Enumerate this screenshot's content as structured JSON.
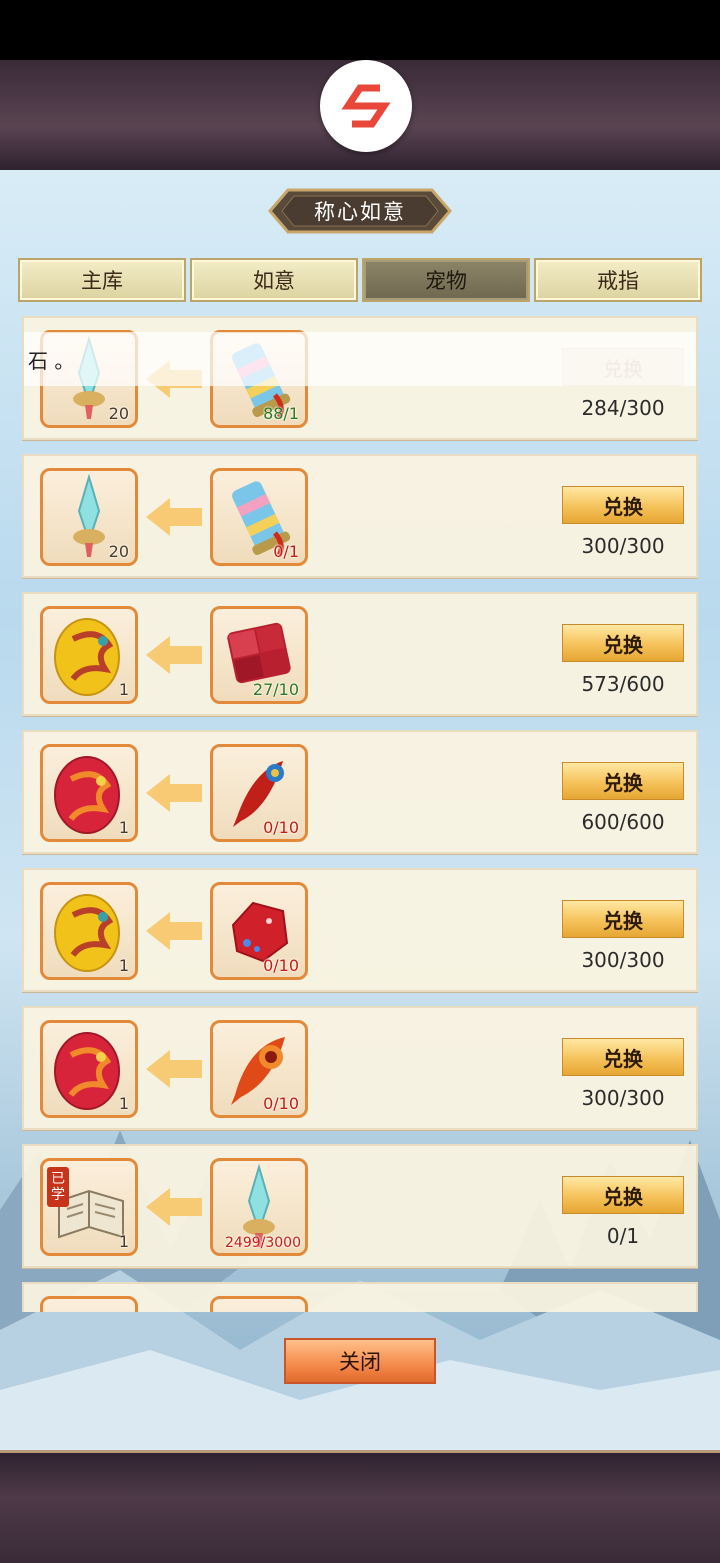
{
  "window": {
    "title": "称心如意"
  },
  "tabs": [
    {
      "label": "主库",
      "active": false
    },
    {
      "label": "如意",
      "active": false
    },
    {
      "label": "宠物",
      "active": true
    },
    {
      "label": "戒指",
      "active": false
    }
  ],
  "toast": {
    "text": "石 。"
  },
  "rows": [
    {
      "reward_icon": "sword-icon",
      "reward_count": "20",
      "cost_icon": "scroll-icon",
      "cost_count": "88/1",
      "cost_color": "green",
      "button_label": "兑换",
      "button_enabled": false,
      "progress": "284/300"
    },
    {
      "reward_icon": "sword-icon",
      "reward_count": "20",
      "cost_icon": "scroll-icon",
      "cost_count": "0/1",
      "cost_color": "red",
      "button_label": "兑换",
      "button_enabled": true,
      "progress": "300/300"
    },
    {
      "reward_icon": "golden-dragon-egg-icon",
      "reward_count": "1",
      "cost_icon": "red-gem-icon",
      "cost_count": "27/10",
      "cost_color": "green",
      "button_label": "兑换",
      "button_enabled": true,
      "progress": "573/600"
    },
    {
      "reward_icon": "red-dragon-egg-icon",
      "reward_count": "1",
      "cost_icon": "feather-icon",
      "cost_count": "0/10",
      "cost_color": "red",
      "button_label": "兑换",
      "button_enabled": true,
      "progress": "600/600"
    },
    {
      "reward_icon": "golden-dragon-egg-icon",
      "reward_count": "1",
      "cost_icon": "red-crystal-icon",
      "cost_count": "0/10",
      "cost_color": "red",
      "button_label": "兑换",
      "button_enabled": true,
      "progress": "300/300"
    },
    {
      "reward_icon": "red-dragon-egg-icon",
      "reward_count": "1",
      "cost_icon": "fire-feather-icon",
      "cost_count": "0/10",
      "cost_color": "red",
      "button_label": "兑换",
      "button_enabled": true,
      "progress": "300/300"
    },
    {
      "reward_icon": "skill-book-icon",
      "reward_badge": "已学",
      "reward_count": "1",
      "cost_icon": "sword-icon",
      "cost_count": "2499/3000",
      "cost_color": "red",
      "button_label": "兑换",
      "button_enabled": true,
      "progress": "0/1"
    }
  ],
  "footer": {
    "close_label": "关闭"
  },
  "colors": {
    "accent": "#e38a3a",
    "button": "#f5c25a",
    "frame": "#3a2a37"
  }
}
